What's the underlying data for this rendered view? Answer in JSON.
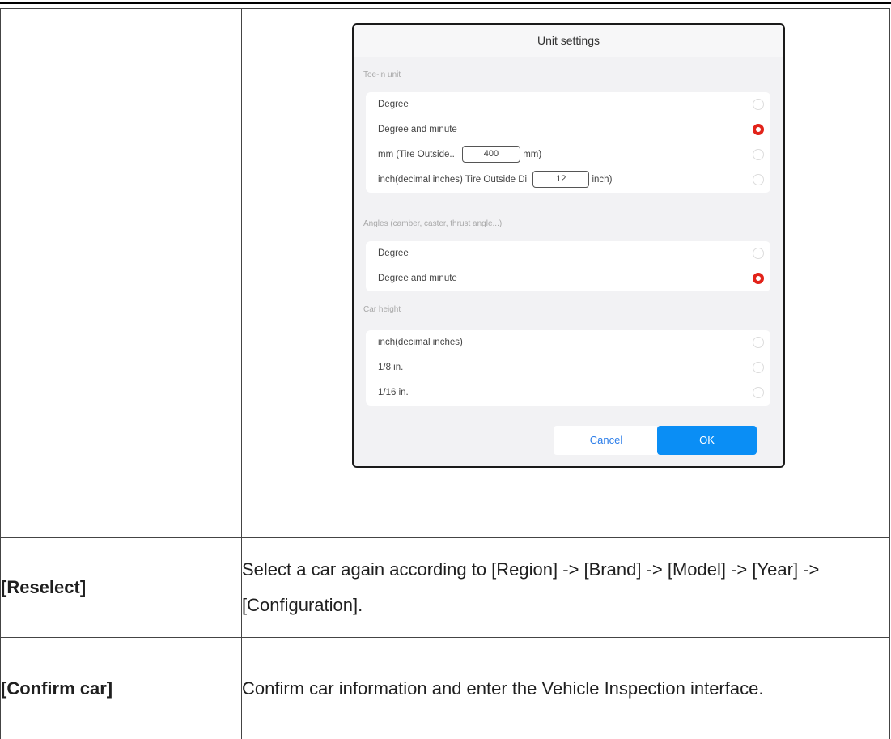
{
  "dialog": {
    "title": "Unit settings",
    "sections": [
      {
        "label": "Toe-in unit",
        "options": [
          {
            "label": "Degree",
            "selected": false
          },
          {
            "label": "Degree and minute",
            "selected": true
          },
          {
            "label_prefix": "mm (Tire Outside..",
            "input_value": "400",
            "label_suffix": "mm)",
            "selected": false
          },
          {
            "label_prefix": "inch(decimal inches) Tire Outside Di",
            "input_value": "12",
            "label_suffix": "inch)",
            "selected": false
          }
        ]
      },
      {
        "label": "Angles (camber, caster, thrust angle...)",
        "options": [
          {
            "label": "Degree",
            "selected": false
          },
          {
            "label": "Degree and minute",
            "selected": true
          }
        ]
      },
      {
        "label": "Car height",
        "options": [
          {
            "label": "inch(decimal inches)",
            "selected": false
          },
          {
            "label": "1/8 in.",
            "selected": false
          },
          {
            "label": "1/16 in.",
            "selected": false
          }
        ]
      }
    ],
    "cancel_label": "Cancel",
    "ok_label": "OK"
  },
  "table": {
    "rows": [
      {
        "label": "[Reselect]",
        "description": "Select a car again according to [Region] -> [Brand] -> [Model] -> [Year] -> [Configuration]."
      },
      {
        "label": "[Confirm car]",
        "description": "Confirm car information and enter the Vehicle Inspection interface."
      }
    ]
  },
  "colors": {
    "accent_red": "#e2231a",
    "button_blue": "#0a8ef5",
    "link_blue": "#2b7de9"
  }
}
